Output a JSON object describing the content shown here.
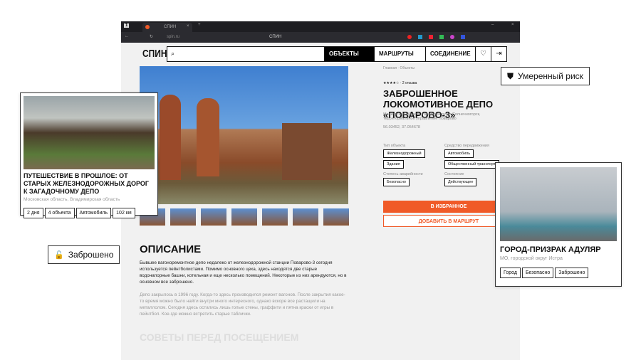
{
  "browser": {
    "tab_title": "СПИН",
    "tab_count": "1",
    "url": "spin.ru",
    "page_title": "СПИН"
  },
  "header": {
    "logo": "СПИН",
    "nav": [
      "ОБЪЕКТЫ",
      "МАРШРУТЫ",
      "СОЕДИНЕНИЕ"
    ]
  },
  "breadcrumb": "Главная · Объекты",
  "rating": {
    "stars": 4,
    "max": 5,
    "reviews": "2 отзыва"
  },
  "object": {
    "title": "ЗАБРОШЕННОЕ ЛОКОМОТИВНОЕ ДЕПО «ПОВАРОВО-3»",
    "address": "Московская область, городской округ Солнечногорск, территориальное управление Поварово",
    "coords": "56.03452, 37.054678"
  },
  "attributes": {
    "type_label": "Тип объекта",
    "types": [
      "Железнодорожный",
      "Здания"
    ],
    "transport_label": "Средство передвижения",
    "transport": [
      "Автомобиль",
      "Общественный транспорт"
    ],
    "danger_label": "Степень аварийности",
    "danger": "Безопасно",
    "state_label": "Состояние",
    "state": "Действующее"
  },
  "actions": {
    "favorite": "В ИЗБРАННОЕ",
    "route": "ДОБАВИТЬ В МАРШРУТ"
  },
  "description": {
    "heading": "ОПИСАНИЕ",
    "p1": "Бывшее вагоноремонтное депо недалеко от железнодорожной станции Поварово-3 сегодня используется пейнтболистами. Помимо основного цеха, здесь находятся две старые водонапорные башни, котельная и еще несколько помещений. Некоторые из них арендуются, но в основном все заброшено.",
    "p2": "Депо закрылось в 1996 году. Когда-то здесь производился ремонт вагонов. После закрытия какое-то время можно было найти внутри много интересного, однако вскоре все растащили на металлолом. Сегодня здесь остались лишь голые стены, граффити и пятна краски от игры в пейнтбол. Кое-где можно встретить старые таблички.",
    "next_heading": "СОВЕТЫ ПЕРЕД ПОСЕЩЕНИЕМ"
  },
  "route_card": {
    "title": "ПУТЕШЕСТВИЕ В ПРОШЛОЕ: ОТ СТАРЫХ ЖЕЛЕЗНОДОРОЖНЫХ ДОРОГ К ЗАГАДОЧНОМУ ДЕПО",
    "location": "Московская область, Владимирская область",
    "chips": [
      "2 дня",
      "4 объекта",
      "Автомобиль",
      "102 км"
    ]
  },
  "ghost_card": {
    "title": "ГОРОД-ПРИЗРАК АДУЛЯР",
    "location": "МО, городской округ Истра",
    "chips": [
      "Город",
      "Безопасно",
      "Заброшено"
    ]
  },
  "badges": {
    "risk": "Умеренный риск",
    "abandoned": "Заброшено"
  },
  "colors": {
    "accent": "#f05a28"
  }
}
